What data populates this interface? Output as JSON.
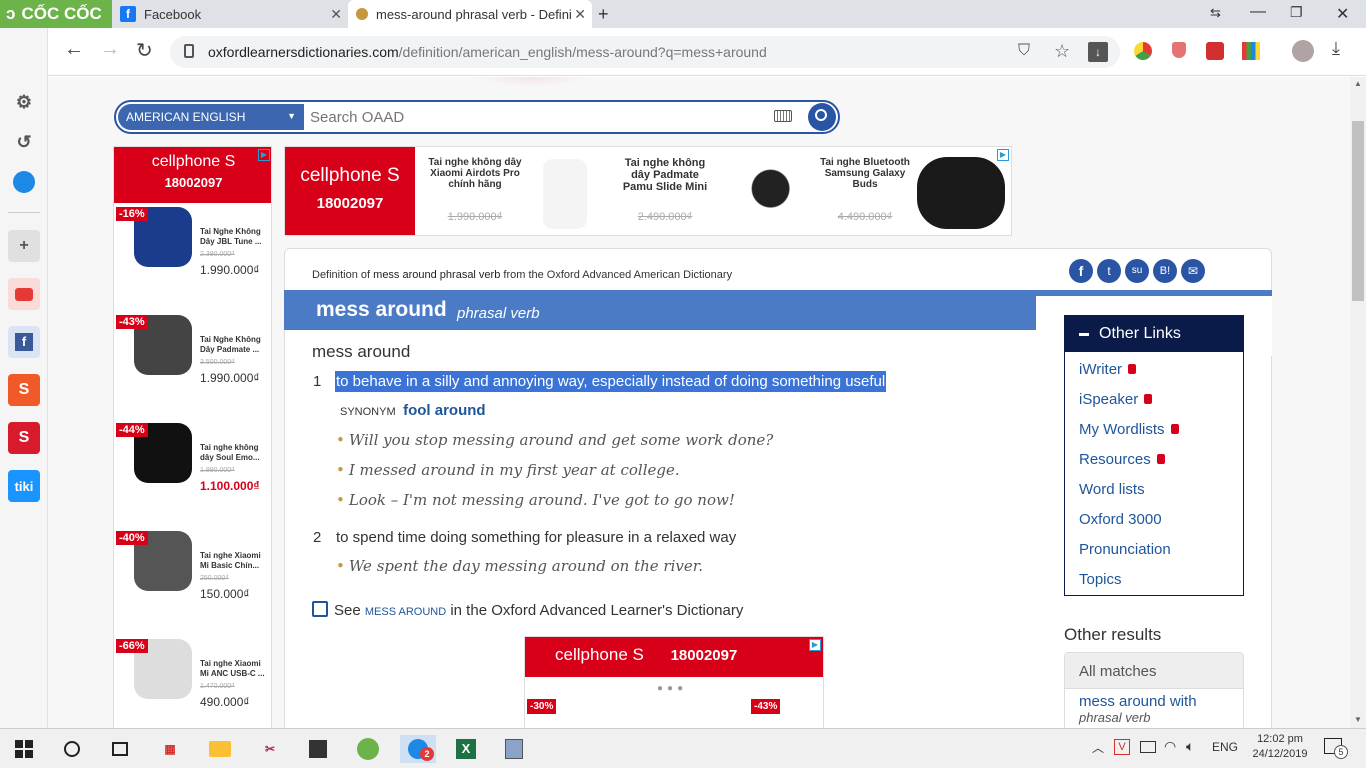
{
  "browser": {
    "brand": "CỐC CỐC",
    "tabs": [
      {
        "label": "Facebook"
      },
      {
        "label": "mess-around phrasal verb - Defini"
      }
    ],
    "url_domain": "oxfordlearnersdictionaries.com",
    "url_path": "/definition/american_english/mess-around?q=mess+around"
  },
  "sidebar": {
    "items": [
      "settings-icon",
      "history-icon",
      "messenger-icon",
      "add-icon",
      "youtube-icon",
      "facebook-icon",
      "shopee-icon",
      "sendo-icon",
      "tiki-icon"
    ],
    "tiki_label": "tiki"
  },
  "search": {
    "dictionary": "AMERICAN ENGLISH",
    "placeholder": "Search OAAD"
  },
  "ads": {
    "brand": "cellphone S",
    "hotline": "18002097",
    "top": [
      {
        "name": "Tai nghe không dây Xiaomi Airdots Pro chính hãng",
        "old_price": "1.990.000₫"
      },
      {
        "name": "Tai nghe không dây Padmate Pamu Slide Mini",
        "old_price": "2.490.000₫"
      },
      {
        "name": "Tai nghe Bluetooth Samsung Galaxy Buds",
        "old_price": "4.490.000₫"
      }
    ],
    "side": [
      {
        "discount": "-16%",
        "name": "Tai Nghe Không Dây JBL Tune ...",
        "old_price": "2.390.000₫",
        "price": "1.990.000₫"
      },
      {
        "discount": "-43%",
        "name": "Tai Nghe Không Dây Padmate ...",
        "old_price": "3.500.000₫",
        "price": "1.990.000₫"
      },
      {
        "discount": "-44%",
        "name": "Tai nghe không dây Soul Emo...",
        "old_price": "1.990.000₫",
        "price": "1.100.000₫"
      },
      {
        "discount": "-40%",
        "name": "Tai nghe Xiaomi Mi Basic Chín...",
        "old_price": "250.000₫",
        "price": "150.000₫"
      },
      {
        "discount": "-66%",
        "name": "Tai nghe Xiaomi Mi ANC USB-C ...",
        "old_price": "1.470.000₫",
        "price": "490.000₫"
      }
    ],
    "bottom_discounts": [
      "-30%",
      "-43%"
    ]
  },
  "entry": {
    "source_prefix": "Definition of",
    "source_term": "mess around phrasal verb",
    "source_suffix": "from the Oxford Advanced American Dictionary",
    "headword": "mess around",
    "pos": "phrasal verb",
    "phrase": "mess around",
    "senses": [
      {
        "num": "1",
        "def": "to behave in a silly and annoying way, especially instead of doing something useful",
        "synonym_label": "SYNONYM",
        "synonym": "fool around",
        "examples": [
          "Will you stop messing around and get some work done?",
          "I messed around in my first year at college.",
          "Look – I'm not messing around. I've got to go now!"
        ]
      },
      {
        "num": "2",
        "def": "to spend time doing something for pleasure in a relaxed way",
        "examples": [
          "We spent the day messing around on the river."
        ]
      }
    ],
    "see_prefix": "See",
    "see_term": "MESS AROUND",
    "see_suffix": "in the Oxford Advanced Learner's Dictionary"
  },
  "other_links": {
    "title": "Other Links",
    "items": [
      {
        "label": "iWriter",
        "locked": true
      },
      {
        "label": "iSpeaker",
        "locked": true
      },
      {
        "label": "My Wordlists",
        "locked": true
      },
      {
        "label": "Resources",
        "locked": true
      },
      {
        "label": "Word lists",
        "locked": false
      },
      {
        "label": "Oxford 3000",
        "locked": false
      },
      {
        "label": "Pronunciation",
        "locked": false
      },
      {
        "label": "Topics",
        "locked": false
      }
    ]
  },
  "other_results": {
    "title": "Other results",
    "tab": "All matches",
    "items": [
      {
        "term": "mess around with",
        "pos": "phrasal verb"
      }
    ]
  },
  "taskbar": {
    "language": "ENG",
    "time": "12:02 pm",
    "date": "24/12/2019",
    "notifications": "5",
    "zalo_badge": "2"
  },
  "colors": {
    "accent": "#4a7bc4",
    "dark_navy": "#0a1b4a",
    "selection": "#3b74d6",
    "coccoc_green": "#6cb34a",
    "cellphones_red": "#d70018"
  }
}
